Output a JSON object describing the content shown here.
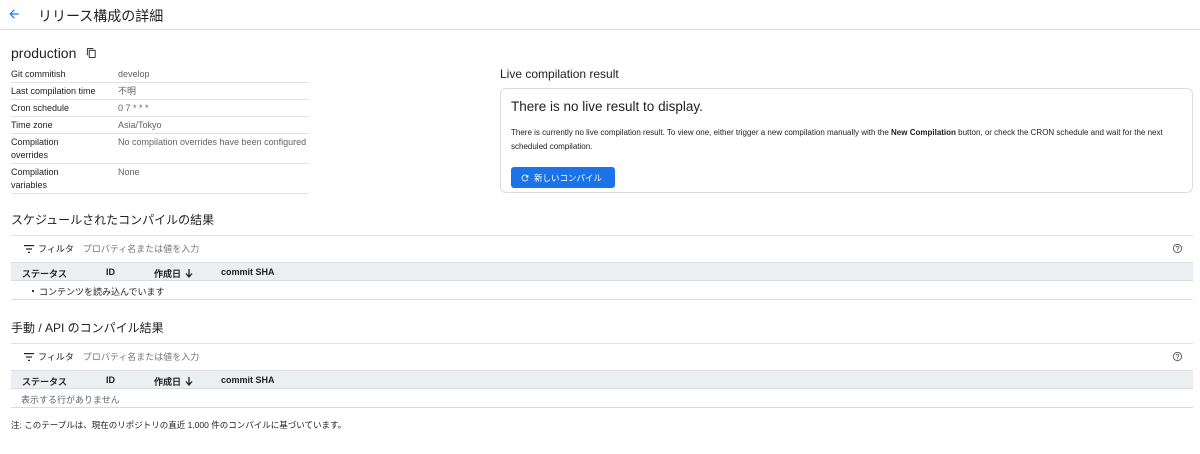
{
  "header": {
    "title": "リリース構成の詳細",
    "back_icon": "arrow-back-icon"
  },
  "config": {
    "name": "production",
    "properties": [
      {
        "key": "Git commitish",
        "value": "develop"
      },
      {
        "key": "Last compilation time",
        "value": "不明"
      },
      {
        "key": "Cron schedule",
        "value": "0 7 * * *"
      },
      {
        "key": "Time zone",
        "value": "Asia/Tokyo"
      },
      {
        "key": "Compilation overrides",
        "value": "No compilation overrides have been configured"
      },
      {
        "key": "Compilation variables",
        "value": "None"
      }
    ]
  },
  "live": {
    "heading": "Live compilation result",
    "card_title": "There is no live result to display.",
    "desc_before": "There is currently no live compilation result. To view one, either trigger a new compilation manually with the ",
    "desc_bold": "New Compilation",
    "desc_after": " button, or check the CRON schedule and wait for the next scheduled compilation.",
    "button_label": "新しいコンパイル"
  },
  "scheduled": {
    "title": "スケジュールされたコンパイルの結果",
    "filter_label": "フィルタ",
    "filter_placeholder": "プロパティ名または値を入力",
    "columns": [
      "ステータス",
      "ID",
      "作成日",
      "commit SHA"
    ],
    "body_message": "コンテンツを読み込んでいます"
  },
  "manual": {
    "title": "手動 / API のコンパイル結果",
    "filter_label": "フィルタ",
    "filter_placeholder": "プロパティ名または値を入力",
    "columns": [
      "ステータス",
      "ID",
      "作成日",
      "commit SHA"
    ],
    "body_message": "表示する行がありません"
  },
  "footnote": "注: このテーブルは、現在のリポジトリの直近 1,000 件のコンパイルに基づいています。",
  "colors": {
    "accent": "#1a73e8",
    "header_bg": "#eceff1",
    "border": "#dadce0"
  }
}
